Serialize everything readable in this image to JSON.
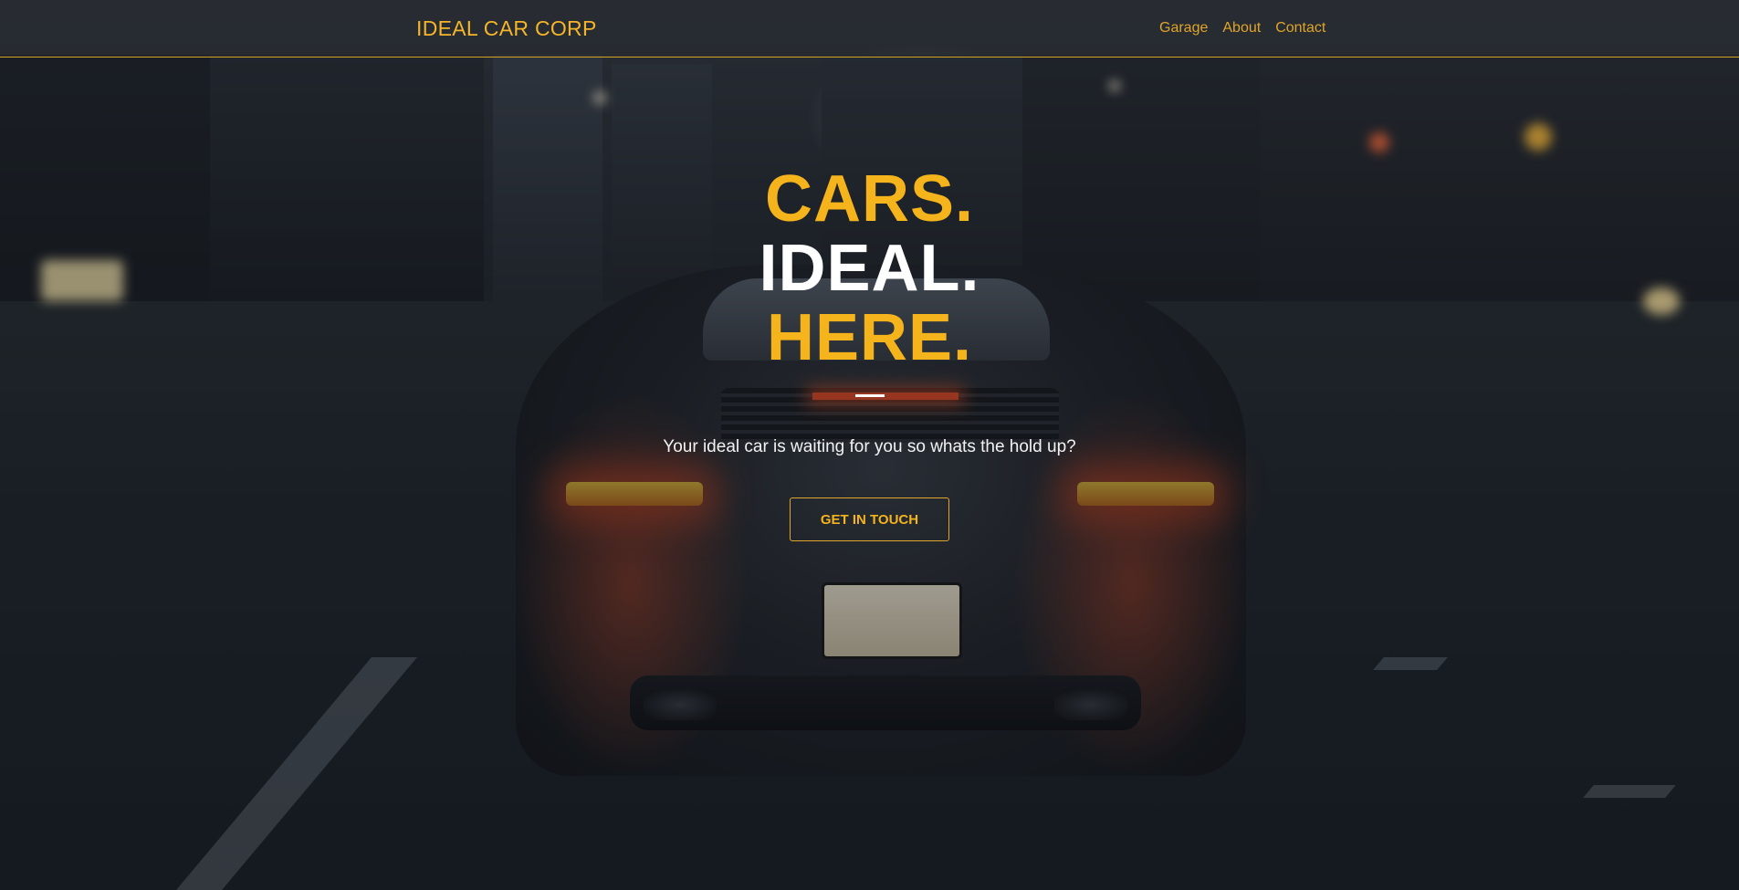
{
  "header": {
    "brand": "IDEAL CAR CORP",
    "nav": [
      {
        "label": "Garage"
      },
      {
        "label": "About"
      },
      {
        "label": "Contact"
      }
    ]
  },
  "hero": {
    "headline_lines": [
      "CARS.",
      "IDEAL.",
      "HERE."
    ],
    "subtitle": "Your ideal car is waiting for you so whats the hold up?",
    "cta_label": "GET IN TOUCH"
  },
  "colors": {
    "accent": "#f5b31c",
    "header_border": "#d4a420",
    "text_light": "#ffffff"
  },
  "background": {
    "description_icon": "car-street-photo"
  }
}
